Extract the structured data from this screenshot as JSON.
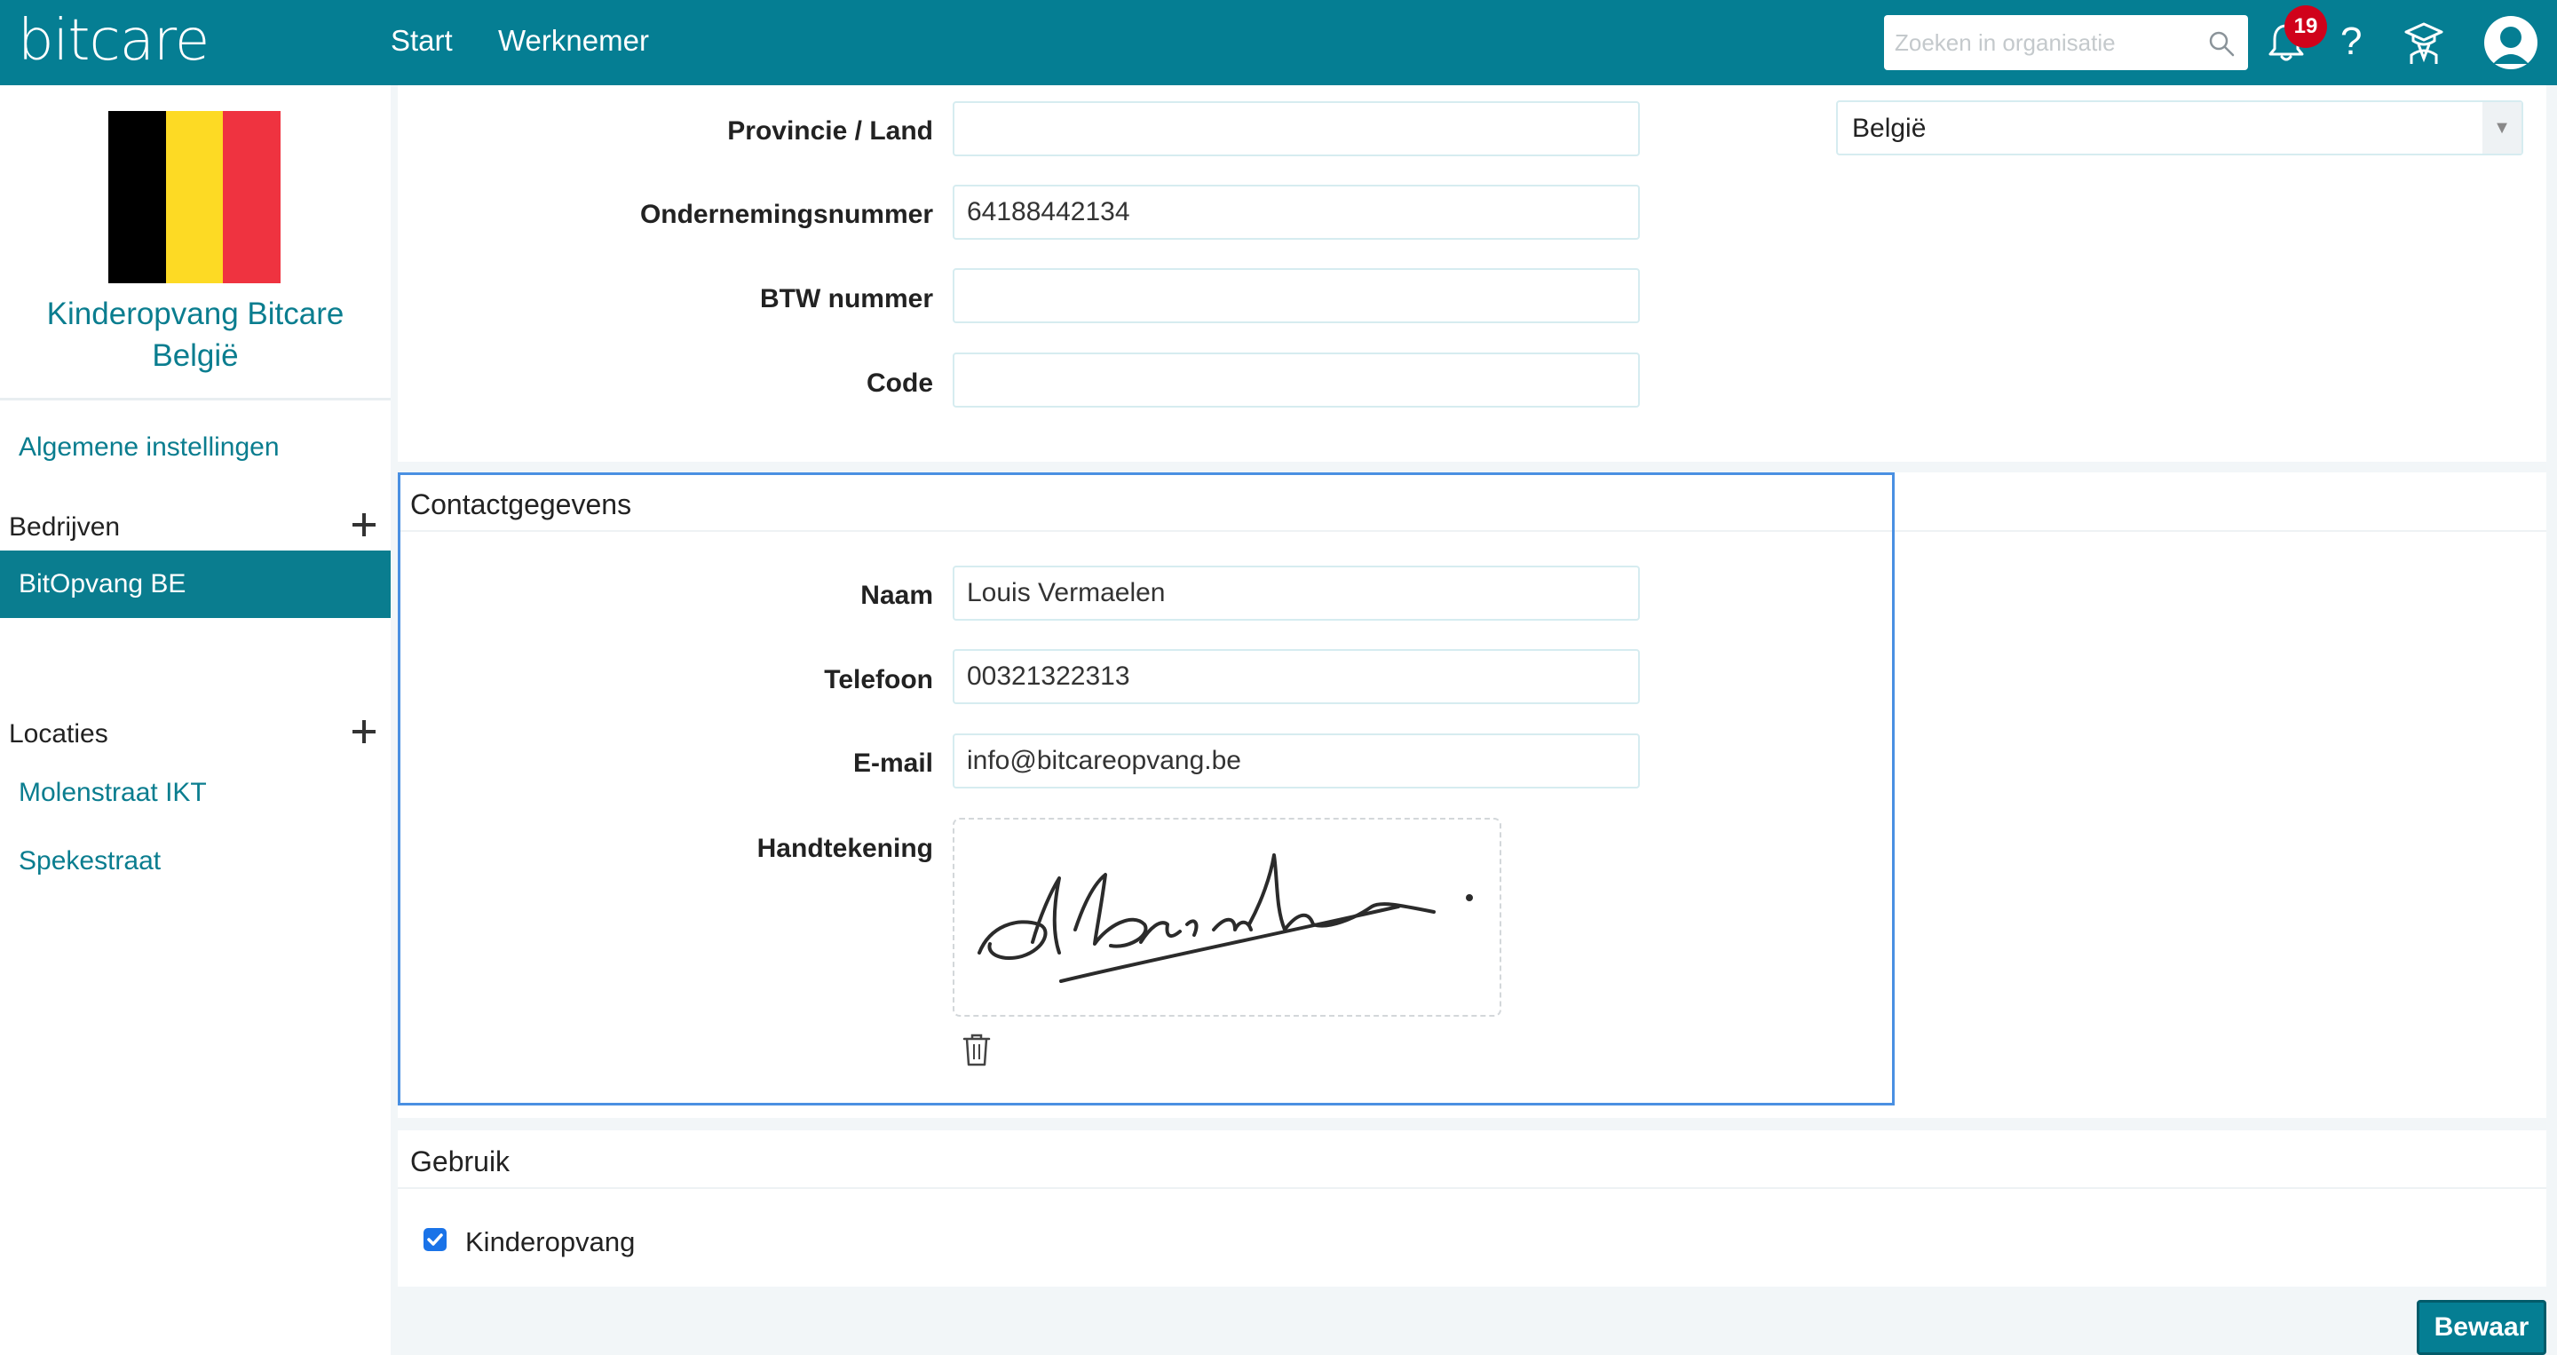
{
  "app": {
    "logo": "bitcare",
    "nav": [
      "Start",
      "Werknemer"
    ],
    "search_placeholder": "Zoeken in organisatie",
    "notification_count": "19",
    "help_label": "?",
    "brand_color": "#057e93"
  },
  "sidebar": {
    "flag_colors": [
      "#000000",
      "#fdda24",
      "#ef3340"
    ],
    "org_name_line1": "Kinderopvang Bitcare",
    "org_name_line2": "België",
    "general_settings": "Algemene instellingen",
    "companies_heading": "Bedrijven",
    "active_company": "BitOpvang BE",
    "locations_heading": "Locaties",
    "locations": [
      "Molenstraat IKT",
      "Spekestraat"
    ]
  },
  "company_form": {
    "province_label": "Provincie / Land",
    "province_value": "",
    "country_value": "België",
    "company_number_label": "Ondernemingsnummer",
    "company_number_value": "64188442134",
    "vat_label": "BTW nummer",
    "vat_value": "",
    "code_label": "Code",
    "code_value": ""
  },
  "contact": {
    "title": "Contactgegevens",
    "name_label": "Naam",
    "name_value": "Louis Vermaelen",
    "phone_label": "Telefoon",
    "phone_value": "00321322313",
    "email_label": "E-mail",
    "email_value": "info@bitcareopvang.be",
    "signature_label": "Handtekening"
  },
  "usage": {
    "title": "Gebruik",
    "childcare_label": "Kinderopvang",
    "childcare_checked": true
  },
  "actions": {
    "save_label": "Bewaar"
  }
}
